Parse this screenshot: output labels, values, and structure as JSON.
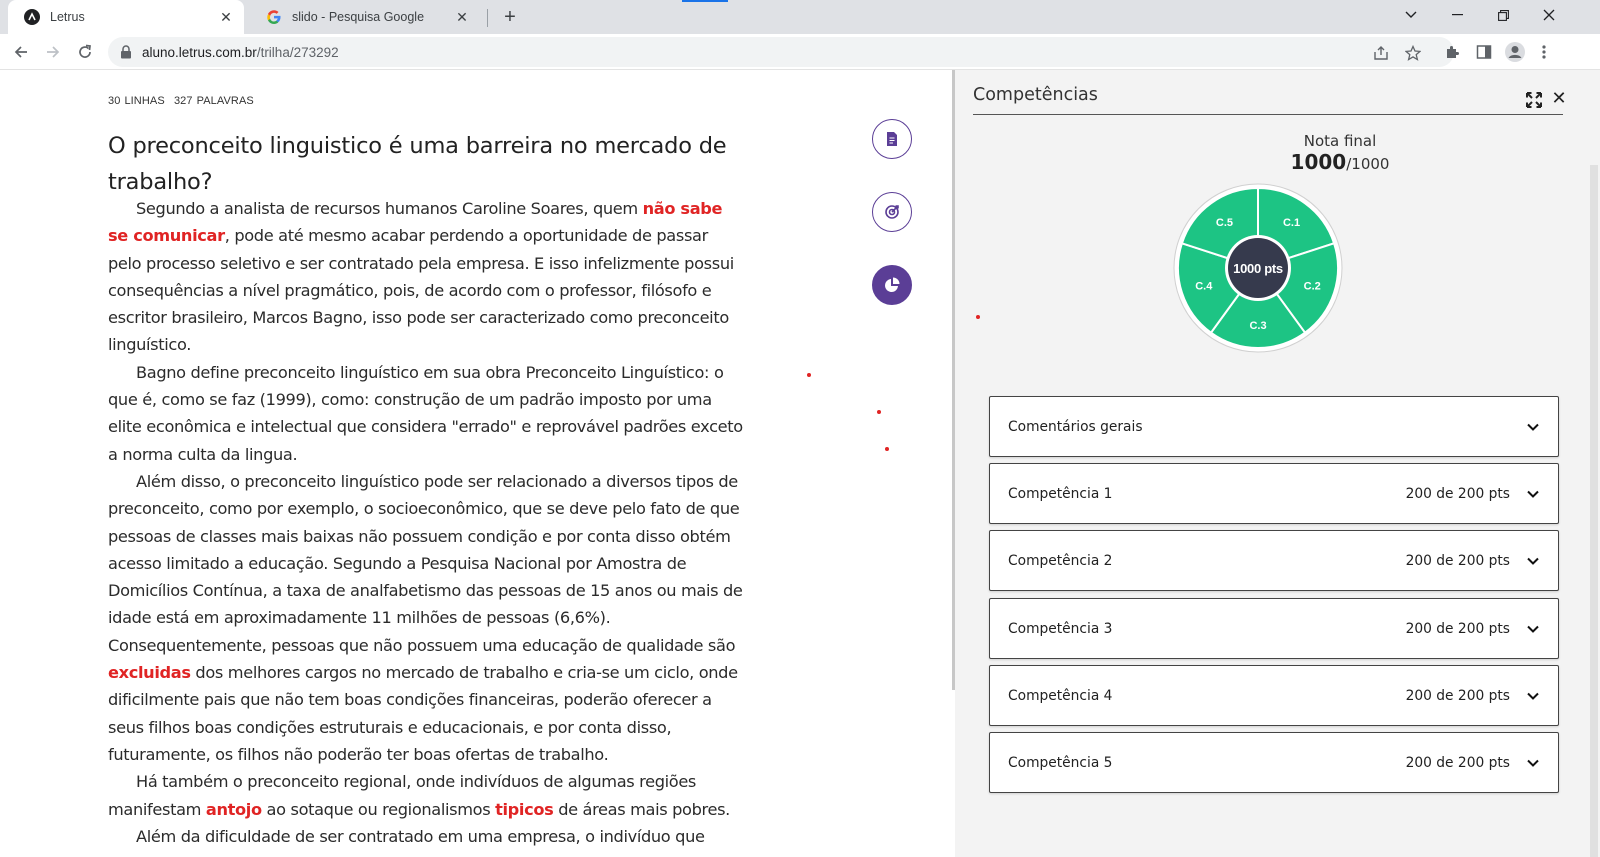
{
  "browser": {
    "tabs": [
      {
        "title": "Letrus",
        "active": true
      },
      {
        "title": "slido - Pesquisa Google",
        "active": false
      }
    ],
    "url_domain": "aluno.letrus.com.br",
    "url_path": "/trilha/273292"
  },
  "essay": {
    "lines_count": "30",
    "lines_label": "LINHAS",
    "words_count": "327",
    "words_label": "PALAVRAS",
    "title": "O preconceito linguistico é uma barreira no mercado de trabalho?",
    "p1": {
      "a": "Segundo a analista de recursos humanos Caroline Soares, quem ",
      "hl": "não sabe se comunicar",
      "b": ", pode até mesmo acabar perdendo a oportunidade de passar pelo processo seletivo e ser contratado pela empresa. E isso infelizmente possui consequências a nível pragmático, pois, de acordo com o professor, filósofo e escritor brasileiro, Marcos Bagno, isso pode ser caracterizado como preconceito linguístico."
    },
    "p2": "Bagno define preconceito linguístico em sua obra Preconceito Linguístico: o que é, como se faz (1999), como: construção de um padrão imposto por uma elite econômica e intelectual que considera \"errado\" e reprovável padrões exceto a norma culta da lingua.",
    "p3": {
      "a": "Além disso, o preconceito linguístico pode ser relacionado a diversos tipos de preconceito, como por exemplo, o socioeconômico, que se deve pelo fato de que pessoas de classes mais baixas não possuem condição e por conta disso obtém acesso limitado a educação. Segundo a Pesquisa Nacional por Amostra de Domicílios Contínua, a taxa de analfabetismo das pessoas de 15 anos ou mais de idade está em aproximadamente 11 milhões de pessoas (6,6%). Consequentemente, pessoas que não possuem uma educação de qualidade são ",
      "hl": "excluidas",
      "b": " dos melhores cargos no mercado de trabalho e cria-se um ciclo, onde dificilmente pais que não tem boas condições financeiras, poderão oferecer a seus filhos boas condições estruturais e educacionais, e por conta disso, futuramente, os filhos não poderão ter boas ofertas de trabalho."
    },
    "p4": {
      "a": "Há também o preconceito regional, onde indivíduos de algumas regiões manifestam ",
      "hl1": "antojo",
      "b": " ao sotaque ou regionalismos ",
      "hl2": "tipicos",
      "c": " de áreas mais pobres."
    },
    "p5": "Além da dificuldade de ser contratado em uma empresa, o indivíduo que sofre"
  },
  "panel": {
    "title": "Competências",
    "nota_label": "Nota final",
    "nota_value": "1000",
    "nota_max": "/1000",
    "center_label": "1000 pts",
    "competencies": [
      {
        "label": "C.1",
        "score": 200
      },
      {
        "label": "C.2",
        "score": 200
      },
      {
        "label": "C.3",
        "score": 200
      },
      {
        "label": "C.4",
        "score": 200
      },
      {
        "label": "C.5",
        "score": 200
      }
    ],
    "accordion": [
      {
        "label": "Comentários gerais",
        "score": ""
      },
      {
        "label": "Competência 1",
        "score": "200 de 200 pts"
      },
      {
        "label": "Competência 2",
        "score": "200 de 200 pts"
      },
      {
        "label": "Competência 3",
        "score": "200 de 200 pts"
      },
      {
        "label": "Competência 4",
        "score": "200 de 200 pts"
      },
      {
        "label": "Competência 5",
        "score": "200 de 200 pts"
      }
    ]
  },
  "colors": {
    "accent_purple": "#5b3e96",
    "highlight_red": "#e02424",
    "pie_green": "#1dc484",
    "pie_center": "#363a4d"
  }
}
